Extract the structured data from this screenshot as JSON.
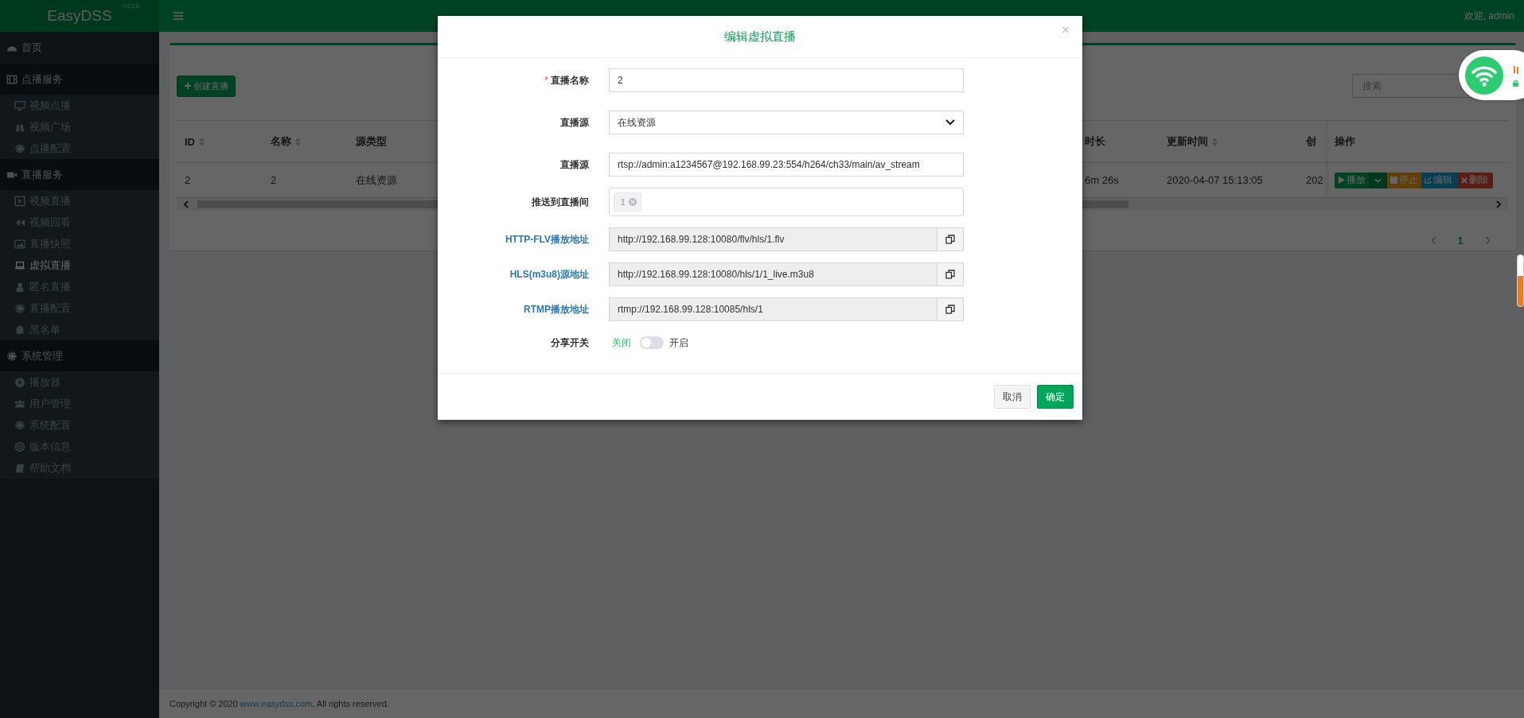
{
  "topbar": {
    "brand": "EasyDSS",
    "version": "V2.2.6",
    "welcome": "欢迎, admin"
  },
  "sidebar": {
    "items": [
      {
        "label": "首页",
        "selected": false
      },
      {
        "label": "点播服务",
        "children": [
          {
            "label": "视频点播",
            "selected": false
          },
          {
            "label": "视频广场",
            "selected": false
          },
          {
            "label": "点播配置",
            "selected": false
          }
        ]
      },
      {
        "label": "直播服务",
        "children": [
          {
            "label": "视频直播",
            "selected": false
          },
          {
            "label": "视频回看",
            "selected": false
          },
          {
            "label": "直播快照",
            "selected": false
          },
          {
            "label": "虚拟直播",
            "selected": true
          },
          {
            "label": "匿名直播",
            "selected": false
          },
          {
            "label": "直播配置",
            "selected": false
          },
          {
            "label": "黑名单",
            "selected": false
          }
        ]
      },
      {
        "label": "系统管理",
        "children": [
          {
            "label": "播放器",
            "selected": false
          },
          {
            "label": "用户管理",
            "selected": false
          },
          {
            "label": "系统配置",
            "selected": false
          },
          {
            "label": "版本信息",
            "selected": false
          },
          {
            "label": "帮助文档",
            "selected": false
          }
        ]
      }
    ]
  },
  "content": {
    "create_button": "创建直播",
    "search": {
      "placeholder": "搜索"
    },
    "table": {
      "columns": [
        {
          "label": "ID",
          "sortable": true
        },
        {
          "label": "名称",
          "sortable": true
        },
        {
          "label": "源类型",
          "sortable": false
        },
        {
          "label": "时长",
          "sortable": false
        },
        {
          "label": "更新时间",
          "sortable": true
        },
        {
          "label": "创",
          "sortable": false
        },
        {
          "label": "操作"
        }
      ],
      "rows": [
        {
          "cells": [
            "2",
            "2",
            "在线资源",
            "6m 26s",
            "2020-04-07 15:13:05",
            "202"
          ],
          "actions": [
            {
              "kind": "play",
              "label": "播放"
            },
            {
              "kind": "caret"
            },
            {
              "kind": "stop",
              "label": "停止"
            },
            {
              "kind": "edit",
              "label": "编辑"
            },
            {
              "kind": "delete",
              "label": "删除"
            }
          ]
        }
      ]
    },
    "pagination": {
      "pages": [
        {
          "label": "1",
          "selected": true
        }
      ]
    }
  },
  "modal": {
    "title": "编辑虚拟直播",
    "close": "×",
    "required_mark": "*",
    "fields": [
      {
        "kind": "text",
        "label": "直播名称",
        "required": true,
        "value": "2"
      },
      {
        "kind": "select",
        "label": "直播源",
        "required": false,
        "value": "在线资源"
      },
      {
        "kind": "text",
        "label": "直播源",
        "required": false,
        "value": "rtsp://admin:a1234567@192.168.99.23:554/h264/ch33/main/av_stream"
      },
      {
        "kind": "tags",
        "label": "推送到直播间",
        "required": false,
        "tags": [
          "1"
        ]
      },
      {
        "kind": "copy",
        "label": "HTTP-FLV播放地址",
        "required": false,
        "value": "http://192.168.99.128:10080/flv/hls/1.flv"
      },
      {
        "kind": "copy",
        "label": "HLS(m3u8)源地址",
        "required": false,
        "value": "http://192.168.99.128:10080/hls/1/1_live.m3u8"
      },
      {
        "kind": "copy",
        "label": "RTMP播放地址",
        "required": false,
        "value": "rtmp://192.168.99.128:10085/hls/1"
      },
      {
        "kind": "switch",
        "label": "分享开关",
        "required": false,
        "off_label": "关闭",
        "on_label": "开启",
        "on": false
      }
    ],
    "buttons": [
      {
        "kind": "default",
        "label": "取消"
      },
      {
        "kind": "primary",
        "label": "确定"
      }
    ]
  },
  "footer": {
    "prefix": "Copyright © 2020 ",
    "link": "www.easydss.com",
    "suffix": ". All rights reserved."
  }
}
